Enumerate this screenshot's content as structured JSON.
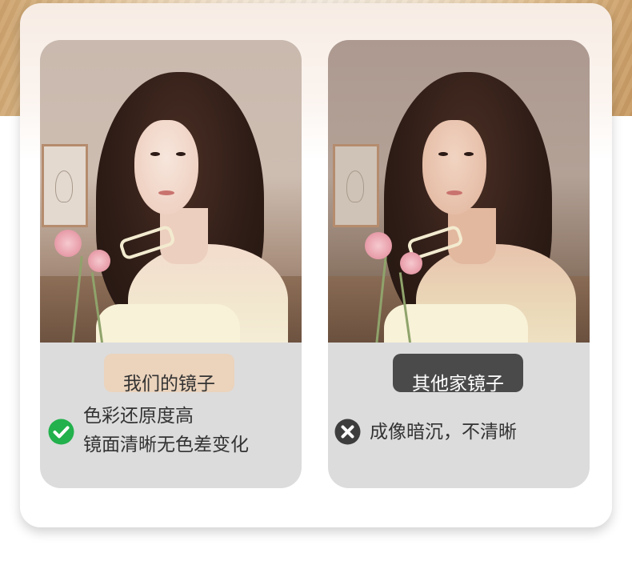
{
  "left_panel": {
    "title": "我们的镜子",
    "lines": [
      "色彩还原度高",
      "镜面清晰无色差变化"
    ],
    "status_icon": "check-circle-icon",
    "accent_color": "#22b14c"
  },
  "right_panel": {
    "title": "其他家镜子",
    "lines": [
      "成像暗沉，不清晰"
    ],
    "status_icon": "x-circle-icon",
    "accent_color": "#3d3d3d"
  }
}
